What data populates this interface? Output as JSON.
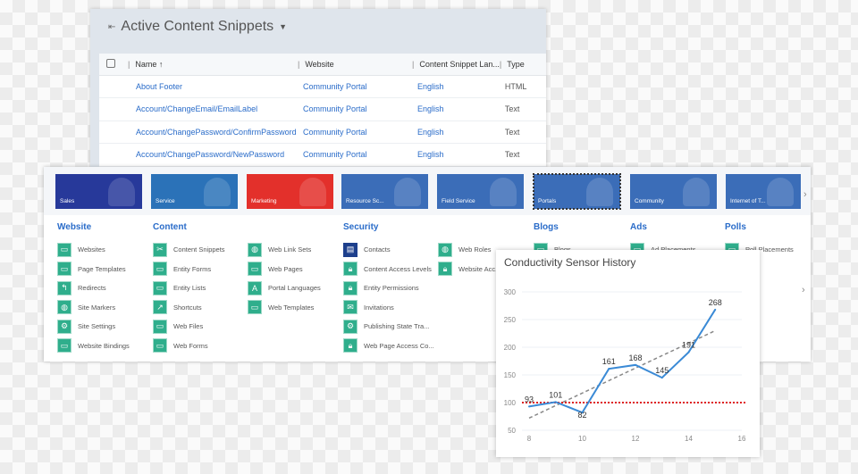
{
  "snippets": {
    "title": "Active Content Snippets",
    "columns": [
      "Name",
      "Website",
      "Content Snippet Lan...",
      "Type"
    ],
    "rows": [
      [
        "About Footer",
        "Community Portal",
        "English",
        "HTML"
      ],
      [
        "Account/ChangeEmail/EmailLabel",
        "Community Portal",
        "English",
        "Text"
      ],
      [
        "Account/ChangePassword/ConfirmPassword",
        "Community Portal",
        "English",
        "Text"
      ],
      [
        "Account/ChangePassword/NewPassword",
        "Community Portal",
        "English",
        "Text"
      ]
    ]
  },
  "tiles": [
    {
      "label": "Sales",
      "color": "#27399a"
    },
    {
      "label": "Service",
      "color": "#2b72b8"
    },
    {
      "label": "Marketing",
      "color": "#e3302b"
    },
    {
      "label": "Resource Sc...",
      "color": "#3b6db8"
    },
    {
      "label": "Field Service",
      "color": "#3b6db8"
    },
    {
      "label": "Portals",
      "color": "#3b6db8",
      "selected": true
    },
    {
      "label": "Community",
      "color": "#3b6db8"
    },
    {
      "label": "Internet of T...",
      "color": "#3b6db8"
    }
  ],
  "sections": [
    {
      "title": "Website",
      "columns": [
        [
          "Websites",
          "Page Templates",
          "Redirects",
          "Site Markers",
          "Site Settings",
          "Website Bindings"
        ]
      ]
    },
    {
      "title": "Content",
      "columns": [
        [
          "Content Snippets",
          "Entity Forms",
          "Entity Lists",
          "Shortcuts",
          "Web Files",
          "Web Forms"
        ],
        [
          "Web Link Sets",
          "Web Pages",
          "Portal Languages",
          "Web Templates"
        ]
      ]
    },
    {
      "title": "Security",
      "columns": [
        [
          "Contacts",
          "Content Access Levels",
          "Entity Permissions",
          "Invitations",
          "Publishing State Tra...",
          "Web Page Access Co..."
        ],
        [
          "Web Roles",
          "Website Acc..."
        ]
      ]
    },
    {
      "title": "Blogs",
      "columns": [
        [
          "Blogs"
        ]
      ]
    },
    {
      "title": "Ads",
      "columns": [
        [
          "Ad Placements"
        ]
      ]
    },
    {
      "title": "Polls",
      "columns": [
        [
          "Poll Placements"
        ]
      ]
    }
  ],
  "chart_data": {
    "type": "line",
    "title": "Conductivity Sensor History",
    "x": [
      8,
      9,
      10,
      11,
      12,
      13,
      14,
      15
    ],
    "series": [
      {
        "values": [
          93,
          101,
          82,
          161,
          168,
          145,
          191,
          268
        ],
        "color": "#3a8ad6"
      }
    ],
    "trendline": {
      "x": [
        8,
        15
      ],
      "y": [
        72,
        230
      ],
      "color": "#888888",
      "style": "dashed"
    },
    "threshold": {
      "y": 100,
      "color": "#e02020",
      "style": "dotted"
    },
    "xlim": [
      8,
      16
    ],
    "ylim": [
      50,
      300
    ],
    "xticks": [
      8,
      10,
      12,
      14,
      16
    ],
    "yticks": [
      50,
      100,
      150,
      200,
      250,
      300
    ],
    "grid": true,
    "data_labels": [
      "93",
      "101",
      "82",
      "161",
      "168",
      "145",
      "191",
      "268"
    ]
  }
}
